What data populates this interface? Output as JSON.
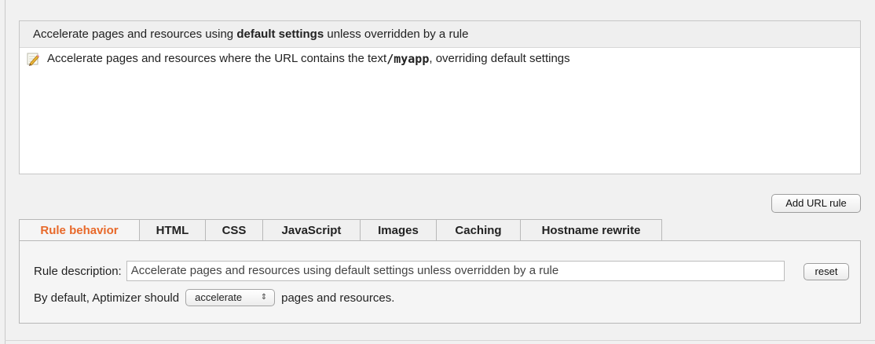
{
  "rules_list": {
    "default_rule": {
      "text_before": "Accelerate pages and resources using ",
      "text_bold": "default settings",
      "text_after": " unless overridden by a rule"
    },
    "url_rule": {
      "icon": "pencil-icon",
      "text_before": "Accelerate pages and resources where the URL contains the text ",
      "url_text": "/myapp",
      "text_after": ", overriding default settings"
    }
  },
  "add_url_rule_label": "Add URL rule",
  "tabs": [
    {
      "label": "Rule behavior",
      "active": true
    },
    {
      "label": "HTML",
      "active": false
    },
    {
      "label": "CSS",
      "active": false
    },
    {
      "label": "JavaScript",
      "active": false
    },
    {
      "label": "Images",
      "active": false
    },
    {
      "label": "Caching",
      "active": false
    },
    {
      "label": "Hostname rewrite",
      "active": false
    }
  ],
  "rule_behavior": {
    "description_label": "Rule description:",
    "description_value": "Accelerate pages and resources using default settings unless overridden by a rule",
    "reset_label": "reset",
    "default_prefix": "By default, Aptimizer should",
    "mode_value": "accelerate",
    "mode_icon": "updown-arrows-icon",
    "default_suffix": "pages and resources."
  },
  "colors": {
    "active_tab": "#e8692a",
    "panel_bg": "#f5f5f5",
    "page_bg": "#f1f1f1"
  }
}
